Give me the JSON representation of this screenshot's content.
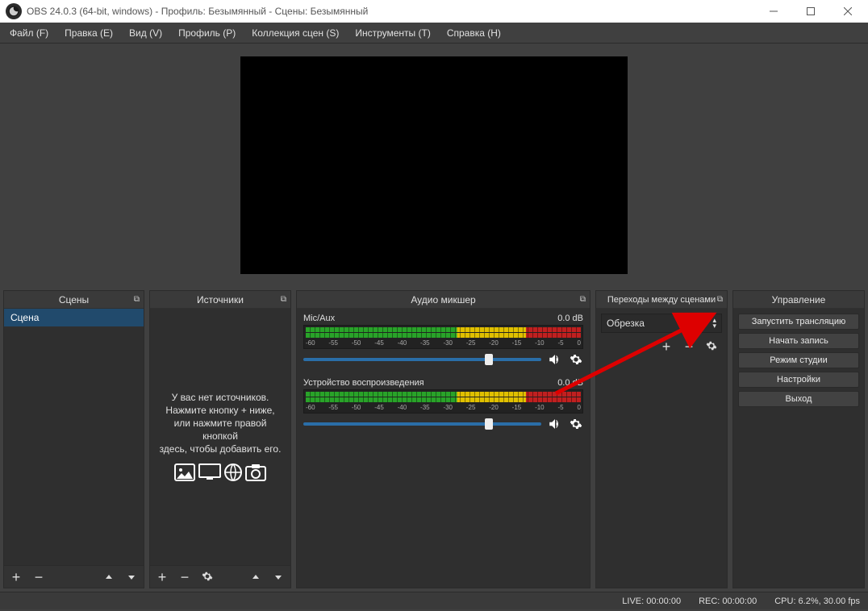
{
  "titlebar": {
    "title": "OBS 24.0.3 (64-bit, windows) - Профиль: Безымянный - Сцены: Безымянный"
  },
  "menu": {
    "file": "Файл (F)",
    "edit": "Правка (E)",
    "view": "Вид (V)",
    "profile": "Профиль (P)",
    "scene_collection": "Коллекция сцен (S)",
    "tools": "Инструменты (T)",
    "help": "Справка (H)"
  },
  "panels": {
    "scenes_title": "Сцены",
    "sources_title": "Источники",
    "mixer_title": "Аудио микшер",
    "transitions_title": "Переходы между сценами",
    "controls_title": "Управление"
  },
  "scenes": {
    "item0": "Сцена"
  },
  "sources_empty": {
    "l1": "У вас нет источников.",
    "l2": "Нажмите кнопку + ниже,",
    "l3": "или нажмите правой кнопкой",
    "l4": "здесь, чтобы добавить его."
  },
  "mixer": {
    "ch0": {
      "name": "Mic/Aux",
      "level": "0.0 dB"
    },
    "ch1": {
      "name": "Устройство воспроизведения",
      "level": "0.0 dB"
    },
    "ticks": {
      "t0": "-60",
      "t1": "-55",
      "t2": "-50",
      "t3": "-45",
      "t4": "-40",
      "t5": "-35",
      "t6": "-30",
      "t7": "-25",
      "t8": "-20",
      "t9": "-15",
      "t10": "-10",
      "t11": "-5",
      "t12": "0"
    }
  },
  "transitions": {
    "selected": "Обрезка"
  },
  "controls": {
    "start_stream": "Запустить трансляцию",
    "start_record": "Начать запись",
    "studio_mode": "Режим студии",
    "settings": "Настройки",
    "exit": "Выход"
  },
  "status": {
    "live": "LIVE: 00:00:00",
    "rec": "REC: 00:00:00",
    "cpu": "CPU: 6.2%, 30.00 fps"
  }
}
